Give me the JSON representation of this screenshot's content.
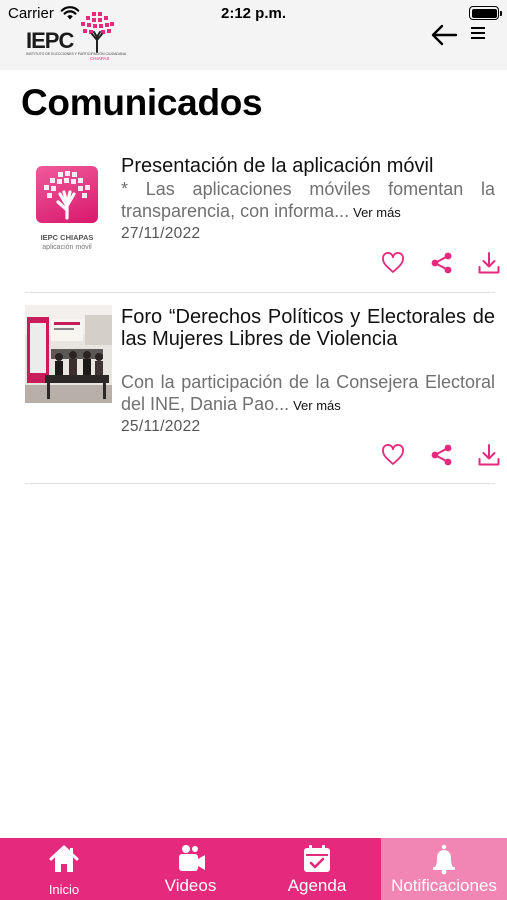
{
  "status_bar": {
    "carrier": "Carrier",
    "time": "2:12 p.m."
  },
  "header": {
    "logo_text": "IEPC",
    "logo_tagline": "INSTITUTO DE ELECCIONES Y PARTICIPACIÓN CIUDADANA",
    "logo_subtext": "CHIAPAS",
    "back_icon": "arrow-left-icon",
    "menu_icon": "hamburger-menu-icon"
  },
  "page": {
    "title": "Comunicados"
  },
  "cards": [
    {
      "title": "Presentación de la aplicación móvil",
      "description": "* Las aplicaciones móviles fomentan la transparencia, con informa...",
      "more": "Ver más",
      "date": "27/11/2022",
      "thumb_brand": "IEPC CHIAPAS",
      "thumb_sub": "aplicación móvil"
    },
    {
      "title": "Foro “Derechos Políticos y Electorales de las Mujeres Libres de Violencia",
      "description": "Con la participación de la Consejera Electoral del INE, Dania Pao...",
      "more": "Ver más",
      "date": "25/11/2022"
    }
  ],
  "tabs": [
    {
      "label": "Inicio",
      "icon": "home-icon"
    },
    {
      "label": "Videos",
      "icon": "video-camera-icon"
    },
    {
      "label": "Agenda",
      "icon": "calendar-icon"
    },
    {
      "label": "Notificaciones",
      "icon": "bell-icon",
      "selected": true
    }
  ],
  "colors": {
    "accent": "#e5297c",
    "accent_selected": "#f186b4",
    "header_bg": "#f4f4f4"
  }
}
